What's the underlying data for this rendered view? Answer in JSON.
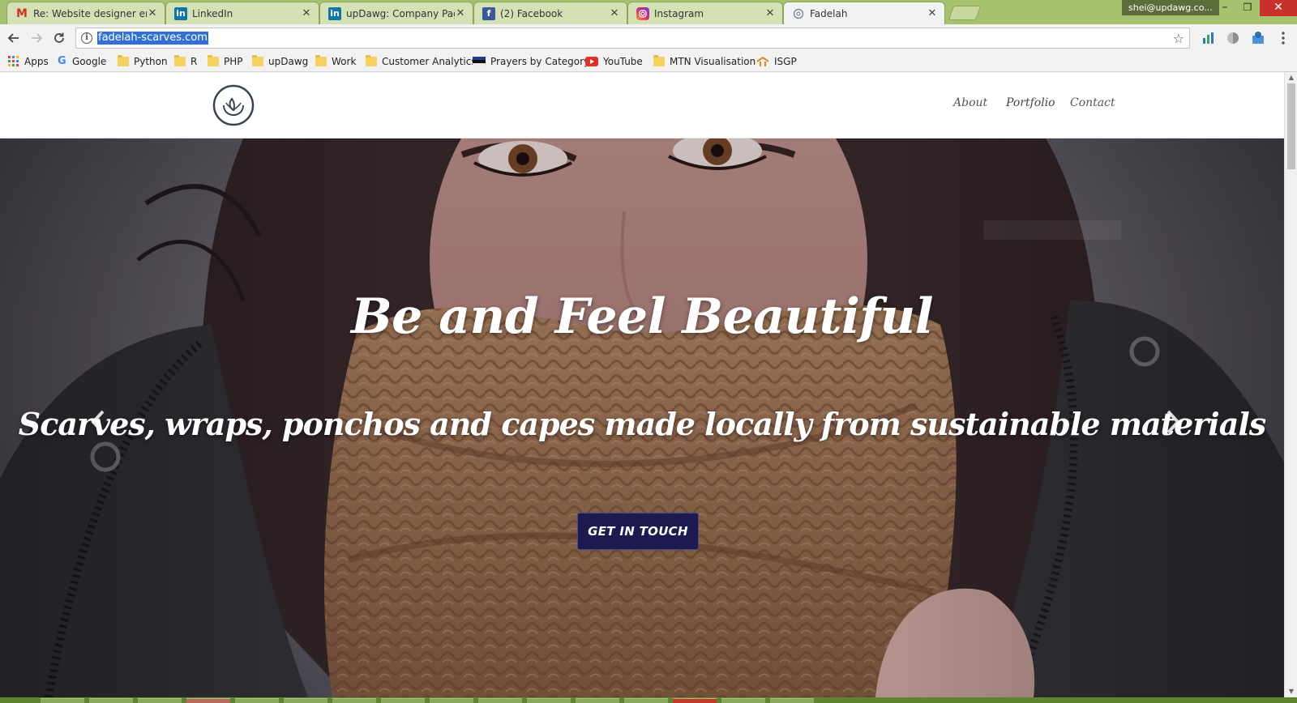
{
  "browser": {
    "tabs": [
      {
        "title": "Re: Website designer em",
        "icon": "gmail-icon",
        "active": false
      },
      {
        "title": "LinkedIn",
        "icon": "linkedin-icon",
        "active": false
      },
      {
        "title": "upDawg: Company Page",
        "icon": "linkedin-icon",
        "active": false
      },
      {
        "title": "(2) Facebook",
        "icon": "facebook-icon",
        "active": false
      },
      {
        "title": "Instagram",
        "icon": "instagram-icon",
        "active": false
      },
      {
        "title": "Fadelah",
        "icon": "globe-icon",
        "active": true
      }
    ],
    "profile": "shei@updawg.co...",
    "url": "fadelah-scarves.com",
    "bookmarks": [
      {
        "label": "Apps",
        "icon": "apps-grid-icon"
      },
      {
        "label": "Google",
        "icon": "google-icon"
      },
      {
        "label": "Python",
        "icon": "folder-icon"
      },
      {
        "label": "R",
        "icon": "folder-icon"
      },
      {
        "label": "PHP",
        "icon": "folder-icon"
      },
      {
        "label": "upDawg",
        "icon": "folder-icon"
      },
      {
        "label": "Work",
        "icon": "folder-icon"
      },
      {
        "label": "Customer Analytics",
        "icon": "folder-icon"
      },
      {
        "label": "Prayers by Category",
        "icon": "flag-icon"
      },
      {
        "label": "YouTube",
        "icon": "youtube-icon"
      },
      {
        "label": "MTN Visualisation",
        "icon": "folder-icon"
      },
      {
        "label": "ISGP",
        "icon": "isgp-icon"
      }
    ]
  },
  "site": {
    "nav": [
      {
        "label": "About"
      },
      {
        "label": "Portfolio"
      },
      {
        "label": "Contact"
      }
    ],
    "hero": {
      "headline": "Be and Feel Beautiful",
      "tagline": "Scarves, wraps, ponchos and capes made locally from sustainable materials",
      "cta": "GET IN TOUCH",
      "slides": 3,
      "current_slide": 1
    }
  },
  "colors": {
    "cta_bg": "#1c1a4e",
    "tabstrip": "#a7c26e",
    "selection": "#3370d6"
  }
}
